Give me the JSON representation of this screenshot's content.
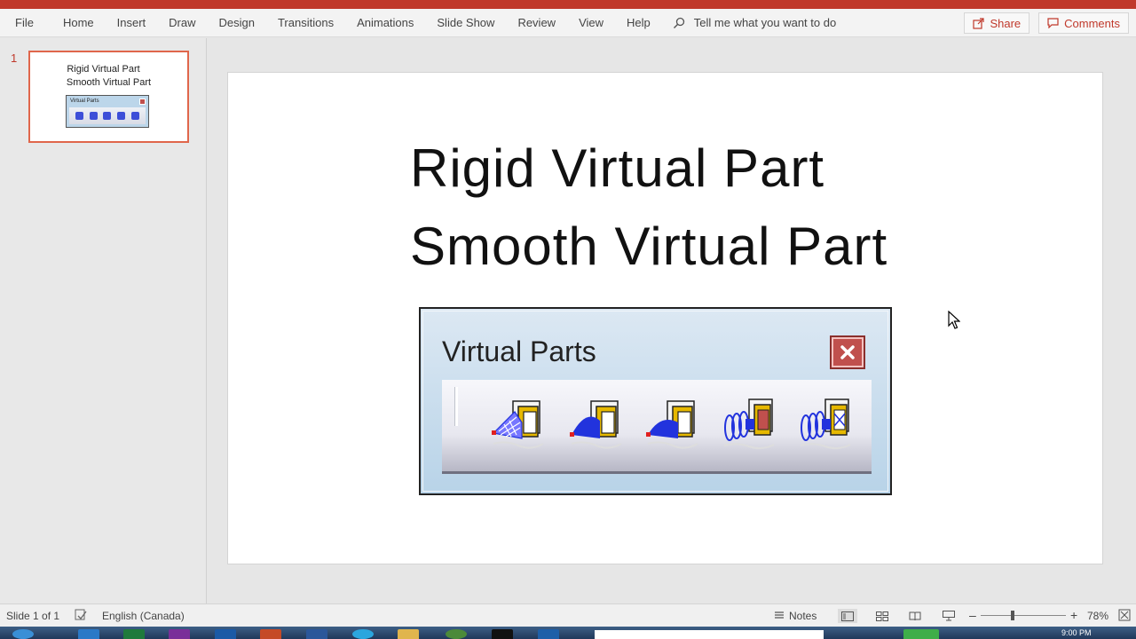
{
  "ribbon": {
    "tabs": [
      "File",
      "Home",
      "Insert",
      "Draw",
      "Design",
      "Transitions",
      "Animations",
      "Slide Show",
      "Review",
      "View",
      "Help"
    ],
    "tell_me": "Tell me what you want to do",
    "share": "Share",
    "comments": "Comments"
  },
  "thumbnails": {
    "slide_number": "1",
    "line1": "Rigid Virtual Part",
    "line2": "Smooth Virtual Part",
    "mini_toolbar_title": "Virtual Parts"
  },
  "slide": {
    "title_line1": "Rigid Virtual Part",
    "title_line2": "Smooth Virtual Part",
    "toolbar": {
      "title": "Virtual Parts",
      "icons": [
        "rigid-virtual-part-icon",
        "smooth-virtual-part-icon",
        "smooth-virtual-part-alt-icon",
        "rigid-spring-virtual-part-icon",
        "smooth-spring-virtual-part-icon"
      ]
    }
  },
  "status": {
    "slide_counter": "Slide 1 of 1",
    "language": "English (Canada)",
    "notes": "Notes",
    "zoom": "78%"
  },
  "taskbar": {
    "clock": "9:00 PM"
  },
  "colors": {
    "accent": "#c0392b",
    "toolbar_bg": "#b8d3e8",
    "close_red": "#c0504d",
    "icon_blue": "#2233dd"
  }
}
